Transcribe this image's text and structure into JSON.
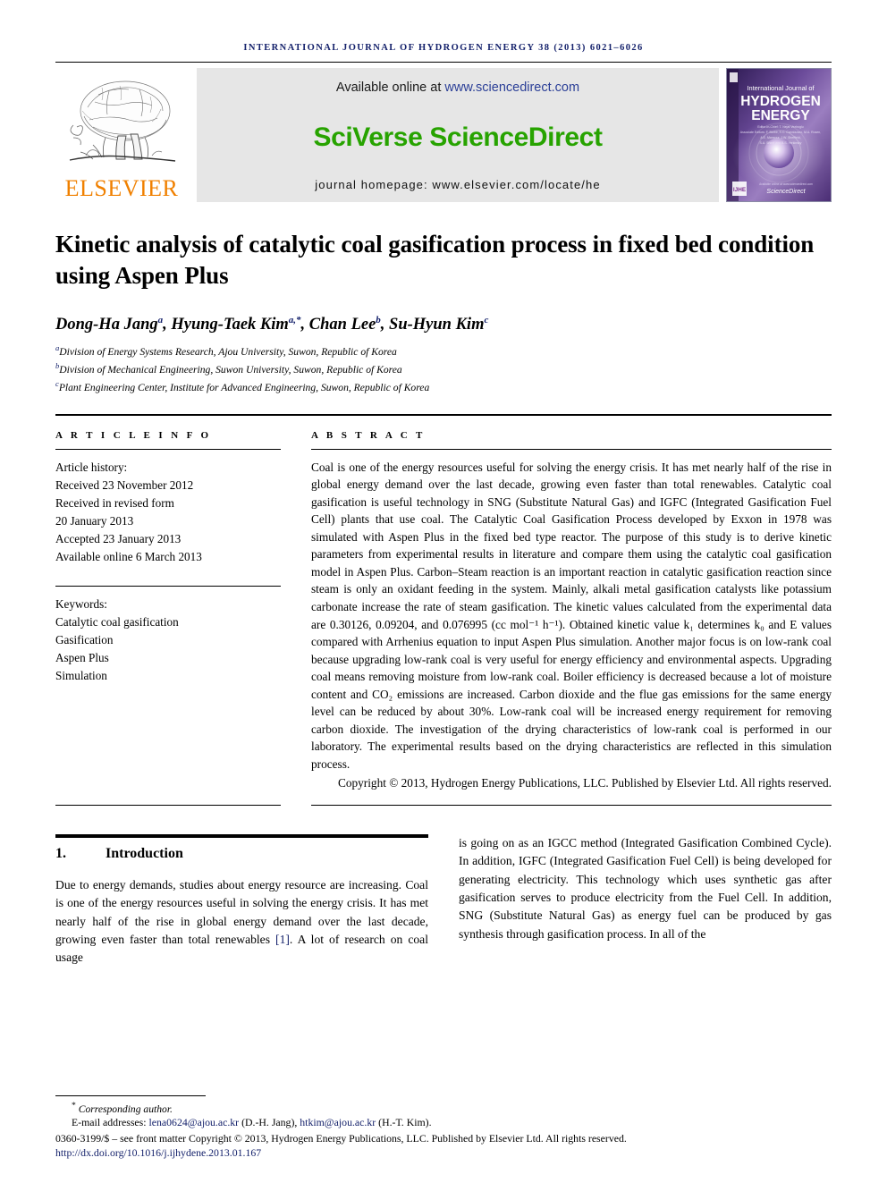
{
  "running_head": "International Journal of Hydrogen Energy 38 (2013) 6021–6026",
  "masthead": {
    "available_prefix": "Available online at ",
    "sciencedirect_url": "www.sciencedirect.com",
    "brand": "SciVerse ScienceDirect",
    "journal_homepage": "journal homepage: www.elsevier.com/locate/he",
    "publisher_logo_word": "ELSEVIER",
    "publisher_logo_color": "#f08000",
    "brand_color": "#27a300",
    "band_color": "#e6e6e6",
    "cover": {
      "line1": "International Journal of",
      "line2": "HYDROGEN",
      "line3": "ENERGY",
      "editors_line1": "Editor-in-Chief:  T. Nejat Veziroğlu",
      "editors_line2": "Associate Editors:  F. Barbir, S.C. Cannizzaro, M.A. Rosen,",
      "editors_line3": "A.E. Mansour, J.W. Sheffield,",
      "editors_line4": "S.A. Sherif and B.S. Yerkinsky",
      "footer_small": "Available online at www.sciencedirect.com",
      "footer_brand": "ScienceDirect",
      "badge": "IJHE"
    }
  },
  "article": {
    "title": "Kinetic analysis of catalytic coal gasification process in fixed bed condition using Aspen Plus",
    "authors": [
      {
        "name": "Dong-Ha Jang",
        "marks": "a"
      },
      {
        "name": "Hyung-Taek Kim",
        "marks": "a,*"
      },
      {
        "name": "Chan Lee",
        "marks": "b"
      },
      {
        "name": "Su-Hyun Kim",
        "marks": "c"
      }
    ],
    "affiliations": [
      {
        "mark": "a",
        "text": "Division of Energy Systems Research, Ajou University, Suwon, Republic of Korea"
      },
      {
        "mark": "b",
        "text": "Division of Mechanical Engineering, Suwon University, Suwon, Republic of Korea"
      },
      {
        "mark": "c",
        "text": "Plant Engineering Center, Institute for Advanced Engineering, Suwon, Republic of Korea"
      }
    ]
  },
  "article_info": {
    "heading": "A R T I C L E  I N F O",
    "history_label": "Article history:",
    "history": [
      "Received 23 November 2012",
      "Received in revised form",
      "20 January 2013",
      "Accepted 23 January 2013",
      "Available online 6 March 2013"
    ],
    "keywords_label": "Keywords:",
    "keywords": [
      "Catalytic coal gasification",
      "Gasification",
      "Aspen Plus",
      "Simulation"
    ]
  },
  "abstract": {
    "heading": "A B S T R A C T",
    "text": "Coal is one of the energy resources useful for solving the energy crisis. It has met nearly half of the rise in global energy demand over the last decade, growing even faster than total renewables. Catalytic coal gasification is useful technology in SNG (Substitute Natural Gas) and IGFC (Integrated Gasification Fuel Cell) plants that use coal. The Catalytic Coal Gasification Process developed by Exxon in 1978 was simulated with Aspen Plus in the fixed bed type reactor. The purpose of this study is to derive kinetic parameters from experimental results in literature and compare them using the catalytic coal gasification model in Aspen Plus. Carbon–Steam reaction is an important reaction in catalytic gasification reaction since steam is only an oxidant feeding in the system. Mainly, alkali metal gasification catalysts like potassium carbonate increase the rate of steam gasification. The kinetic values calculated from the experimental data are 0.30126, 0.09204, and 0.076995 (cc mol⁻¹ h⁻¹). Obtained kinetic value k₁ determines k₀ and E values compared with Arrhenius equation to input Aspen Plus simulation. Another major focus is on low-rank coal because upgrading low-rank coal is very useful for energy efficiency and environmental aspects. Upgrading coal means removing moisture from low-rank coal. Boiler efficiency is decreased because a lot of moisture content and CO₂ emissions are increased. Carbon dioxide and the flue gas emissions for the same energy level can be reduced by about 30%. Low-rank coal will be increased energy requirement for removing carbon dioxide. The investigation of the drying characteristics of low-rank coal is performed in our laboratory. The experimental results based on the drying characteristics are reflected in this simulation process.",
    "copyright": "Copyright © 2013, Hydrogen Energy Publications, LLC. Published by Elsevier Ltd. All rights reserved."
  },
  "introduction": {
    "number": "1.",
    "title": "Introduction",
    "left_text": "Due to energy demands, studies about energy resource are increasing. Coal is one of the energy resources useful in solving the energy crisis. It has met nearly half of the rise in global energy demand over the last decade, growing even faster than total renewables",
    "citation": "[1]",
    "left_text_tail": ". A lot of research on coal usage",
    "right_text": "is going on as an IGCC method (Integrated Gasification Combined Cycle). In addition, IGFC (Integrated Gasification Fuel Cell) is being developed for generating electricity. This technology which uses synthetic gas after gasification serves to produce electricity from the Fuel Cell. In addition, SNG (Substitute Natural Gas) as energy fuel can be produced by gas synthesis through gasification process. In all of the"
  },
  "footnote": {
    "corresponding_mark": "*",
    "corresponding": "Corresponding author.",
    "email_label": "E-mail addresses:",
    "email1": "lena0624@ajou.ac.kr",
    "email1_owner": "(D.-H. Jang),",
    "email2": "htkim@ajou.ac.kr",
    "email2_owner": "(H.-T. Kim).",
    "issn_line": "0360-3199/$ – see front matter Copyright © 2013, Hydrogen Energy Publications, LLC. Published by Elsevier Ltd. All rights reserved.",
    "doi": "http://dx.doi.org/10.1016/j.ijhydene.2013.01.167"
  }
}
